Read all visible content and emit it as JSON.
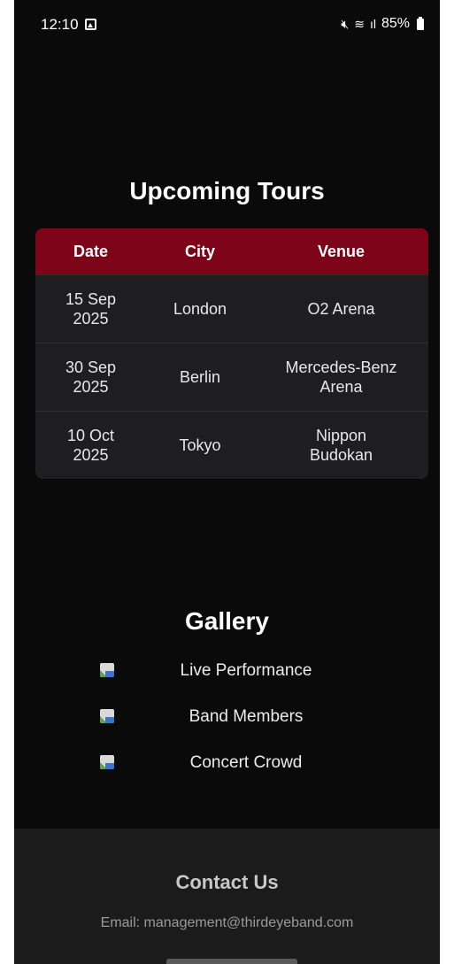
{
  "status_bar": {
    "time": "12:10",
    "battery": "85%",
    "icons": [
      "gallery-icon",
      "mute-icon",
      "wifi-icon",
      "signal-icon",
      "battery-icon"
    ]
  },
  "tours": {
    "title": "Upcoming Tours",
    "headers": {
      "date": "Date",
      "city": "City",
      "venue": "Venue"
    },
    "rows": [
      {
        "date_line1": "15 Sep",
        "date_line2": "2025",
        "city": "London",
        "venue_line1": "O2 Arena",
        "venue_line2": ""
      },
      {
        "date_line1": "30 Sep",
        "date_line2": "2025",
        "city": "Berlin",
        "venue_line1": "Mercedes-Benz",
        "venue_line2": "Arena"
      },
      {
        "date_line1": "10 Oct",
        "date_line2": "2025",
        "city": "Tokyo",
        "venue_line1": "Nippon",
        "venue_line2": "Budokan"
      }
    ],
    "header_color": "#7d0319"
  },
  "gallery": {
    "title": "Gallery",
    "items": [
      "Live Performance",
      "Band Members",
      "Concert Crowd"
    ]
  },
  "contact": {
    "title": "Contact Us",
    "email": "Email: management@thirdeyeband.com"
  }
}
